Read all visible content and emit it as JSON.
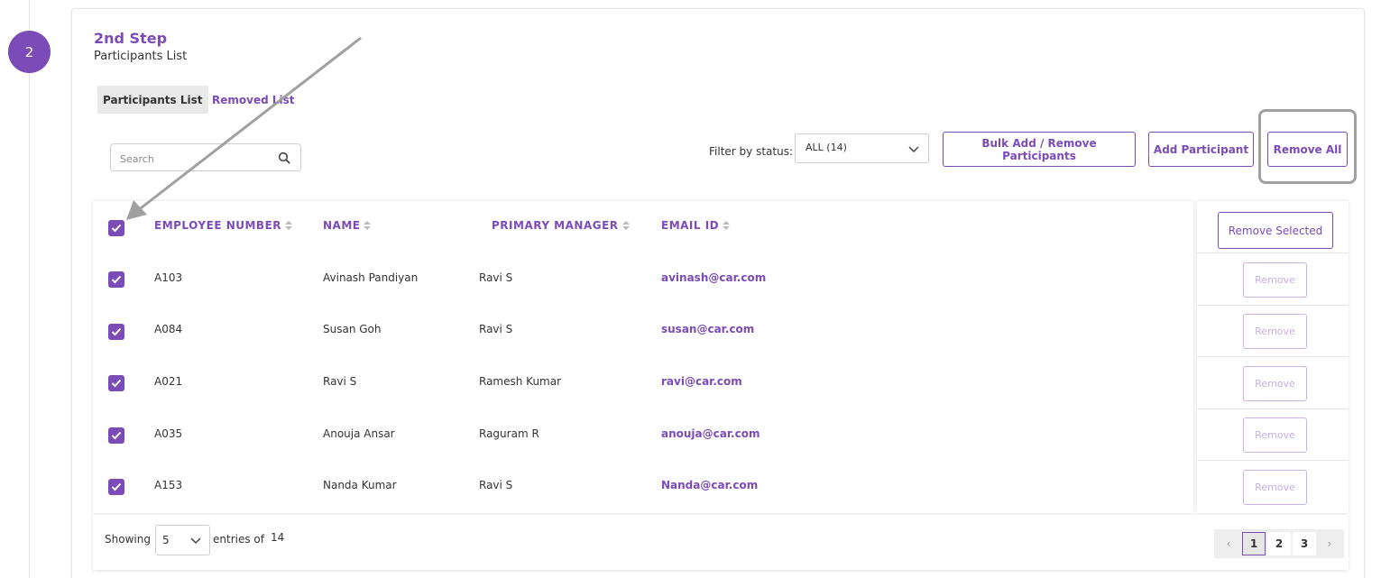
{
  "step": {
    "number": "2",
    "title": "2nd Step",
    "subtitle": "Participants List"
  },
  "tabs": [
    {
      "label": "Participants List",
      "active": true
    },
    {
      "label": "Removed List",
      "active": false
    }
  ],
  "search": {
    "placeholder": "Search",
    "value": ""
  },
  "filter": {
    "label": "Filter by status:",
    "selected": "ALL (14)"
  },
  "toolbar": {
    "bulk_label": "Bulk Add / Remove Participants",
    "add_label": "Add Participant",
    "remove_all_label": "Remove All"
  },
  "table": {
    "columns": [
      "EMPLOYEE NUMBER",
      "NAME",
      "PRIMARY MANAGER",
      "EMAIL ID"
    ],
    "header_checked": true,
    "rows": [
      {
        "employee_number": "A103",
        "name": "Avinash Pandiyan",
        "manager": "Ravi S",
        "email": "avinash@car.com",
        "checked": true
      },
      {
        "employee_number": "A084",
        "name": "Susan Goh",
        "manager": "Ravi S",
        "email": "susan@car.com",
        "checked": true
      },
      {
        "employee_number": "A021",
        "name": "Ravi S",
        "manager": "Ramesh Kumar",
        "email": "ravi@car.com",
        "checked": true
      },
      {
        "employee_number": "A035",
        "name": "Anouja Ansar",
        "manager": "Raguram R",
        "email": "anouja@car.com",
        "checked": true
      },
      {
        "employee_number": "A153",
        "name": "Nanda Kumar",
        "manager": "Ravi S",
        "email": "Nanda@car.com",
        "checked": true
      }
    ]
  },
  "actions": {
    "remove_selected_label": "Remove Selected",
    "remove_label": "Remove"
  },
  "footer": {
    "showing_label": "Showing",
    "entries_value": "5",
    "entries_label": "entries of",
    "total": "14"
  },
  "pagination": {
    "prev": "‹",
    "next": "›",
    "pages": [
      "1",
      "2",
      "3"
    ],
    "current": "1"
  },
  "colors": {
    "accent": "#7b4bb7",
    "annotation": "#a0a0a0"
  }
}
